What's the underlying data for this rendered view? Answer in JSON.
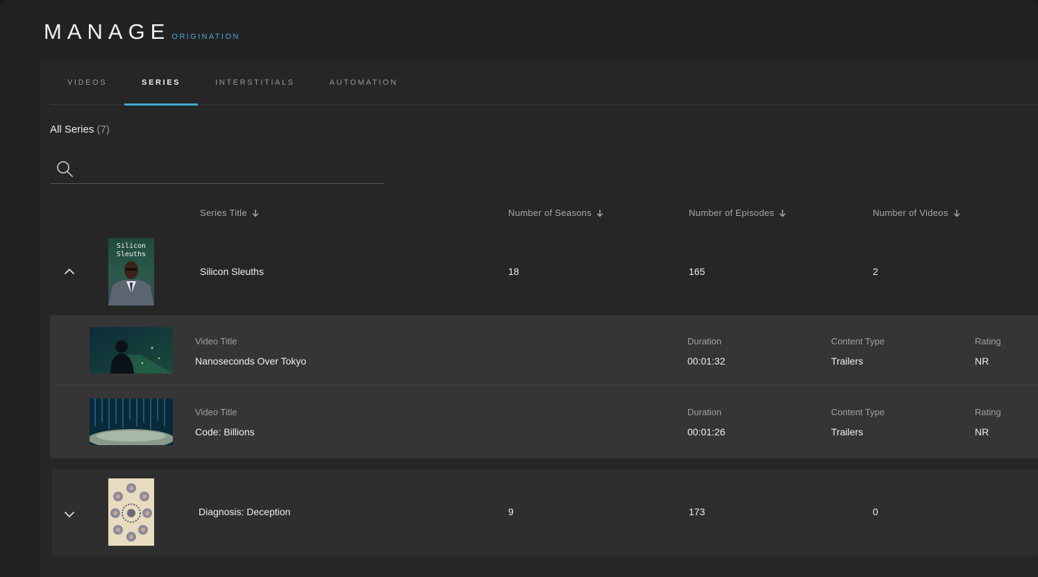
{
  "header": {
    "title": "MANAGE",
    "subtitle": "ORIGINATION"
  },
  "tabs": [
    {
      "label": "VIDEOS",
      "active": false
    },
    {
      "label": "SERIES",
      "active": true
    },
    {
      "label": "INTERSTITIALS",
      "active": false
    },
    {
      "label": "AUTOMATION",
      "active": false
    }
  ],
  "list": {
    "title": "All Series",
    "count": "(7)"
  },
  "search": {
    "placeholder": "",
    "value": ""
  },
  "columns": {
    "title": "Series Title",
    "seasons": "Number of Seasons",
    "episodes": "Number of Episodes",
    "videos": "Number of Videos"
  },
  "series": [
    {
      "title": "Silicon Sleuths",
      "poster_text": "Silicon Sleuths",
      "seasons": "18",
      "episodes": "165",
      "videos": "2",
      "expanded": true,
      "video_items": [
        {
          "title_label": "Video Title",
          "title": "Nanoseconds Over Tokyo",
          "duration_label": "Duration",
          "duration": "00:01:32",
          "type_label": "Content Type",
          "type": "Trailers",
          "rating_label": "Rating",
          "rating": "NR"
        },
        {
          "title_label": "Video Title",
          "title": "Code: Billions",
          "duration_label": "Duration",
          "duration": "00:01:26",
          "type_label": "Content Type",
          "type": "Trailers",
          "rating_label": "Rating",
          "rating": "NR"
        }
      ]
    },
    {
      "title": "Diagnosis: Deception",
      "seasons": "9",
      "episodes": "173",
      "videos": "0",
      "expanded": false
    }
  ],
  "colors": {
    "accent": "#3fa9d8",
    "background": "#222222"
  }
}
